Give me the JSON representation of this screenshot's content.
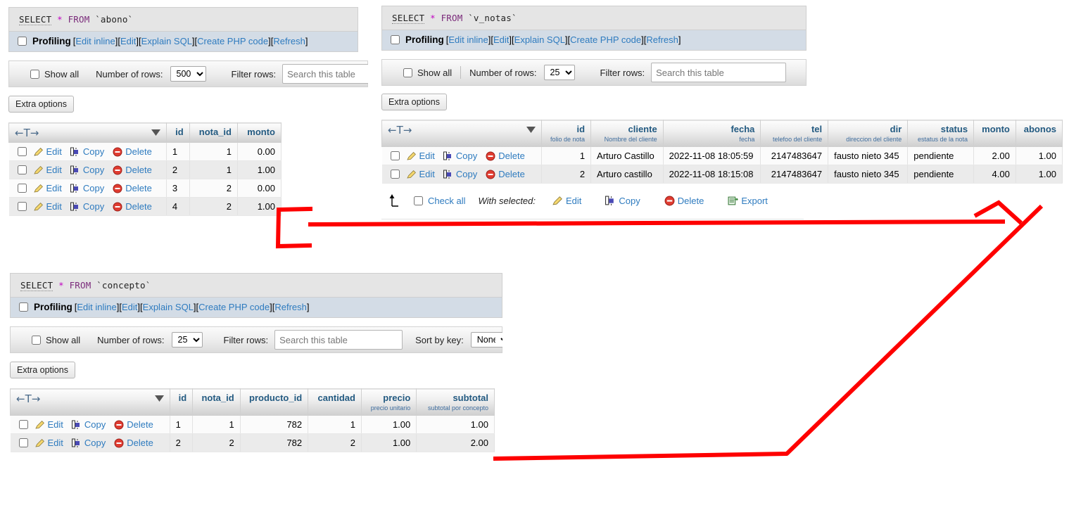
{
  "theme": {
    "link_color": "#2e7bbf",
    "header_color": "#235a81",
    "annotation_color": "#fe0000",
    "profiling_bar_bg": "#d3dce6",
    "sql_box_bg": "#e5e5e5"
  },
  "common": {
    "profiling_label": "Profiling",
    "bracket_open": "[",
    "bracket_close": "]",
    "links": {
      "edit_inline": "Edit inline",
      "edit": "Edit",
      "explain_sql": "Explain SQL",
      "create_php_code": "Create PHP code",
      "refresh": "Refresh"
    },
    "show_all_label": "Show all",
    "number_of_rows_label": "Number of rows:",
    "filter_rows_label": "Filter rows:",
    "search_placeholder": "Search this table",
    "sort_by_key_label": "Sort by key:",
    "extra_options_label": "Extra options",
    "row_actions": {
      "edit": "Edit",
      "copy": "Copy",
      "delete": "Delete",
      "export": "Export"
    },
    "check_all_label": "Check all",
    "with_selected_label": "With selected:",
    "sql_keyword_select": "SELECT",
    "sql_star": "*",
    "sql_keyword_from": "FROM"
  },
  "blocks": [
    {
      "id": "abono",
      "sql_table": "`abono`",
      "rows_per_page": "500",
      "has_sort_by_key": false,
      "columns": [
        {
          "name": "id",
          "comment": ""
        },
        {
          "name": "nota_id",
          "comment": ""
        },
        {
          "name": "monto",
          "comment": ""
        }
      ],
      "rows": [
        [
          "1",
          "1",
          "0.00"
        ],
        [
          "2",
          "1",
          "1.00"
        ],
        [
          "3",
          "2",
          "0.00"
        ],
        [
          "4",
          "2",
          "1.00"
        ]
      ]
    },
    {
      "id": "v_notas",
      "sql_table": "`v_notas`",
      "rows_per_page": "25",
      "has_sort_by_key": false,
      "columns": [
        {
          "name": "id",
          "comment": "folio de nota"
        },
        {
          "name": "cliente",
          "comment": "Nombre del cliente"
        },
        {
          "name": "fecha",
          "comment": "fecha"
        },
        {
          "name": "tel",
          "comment": "telefoo del cliente"
        },
        {
          "name": "dir",
          "comment": "direccion del cliente"
        },
        {
          "name": "status",
          "comment": "estatus de la nota"
        },
        {
          "name": "monto",
          "comment": ""
        },
        {
          "name": "abonos",
          "comment": ""
        }
      ],
      "rows": [
        [
          "1",
          "Arturo Castillo",
          "2022-11-08 18:05:59",
          "2147483647",
          "fausto nieto 345",
          "pendiente",
          "2.00",
          "1.00"
        ],
        [
          "2",
          "Arturo castillo",
          "2022-11-08 18:15:08",
          "2147483647",
          "fausto nieto 345",
          "pendiente",
          "4.00",
          "1.00"
        ]
      ]
    },
    {
      "id": "concepto",
      "sql_table": "`concepto`",
      "rows_per_page": "25",
      "has_sort_by_key": true,
      "sort_by_key_value": "None",
      "columns": [
        {
          "name": "id",
          "comment": ""
        },
        {
          "name": "nota_id",
          "comment": ""
        },
        {
          "name": "producto_id",
          "comment": ""
        },
        {
          "name": "cantidad",
          "comment": ""
        },
        {
          "name": "precio",
          "comment": "precio unitario"
        },
        {
          "name": "subtotal",
          "comment": "subtotal por concepto"
        }
      ],
      "rows": [
        [
          "1",
          "1",
          "782",
          "1",
          "1.00",
          "1.00"
        ],
        [
          "2",
          "2",
          "782",
          "2",
          "1.00",
          "2.00"
        ]
      ]
    }
  ],
  "icons": {
    "pencil": "pencil-icon",
    "copy": "copy-icon",
    "delete": "delete-icon",
    "export": "export-icon",
    "dropdown": "chevron-down-icon",
    "sort": "sort-arrow-icon"
  }
}
